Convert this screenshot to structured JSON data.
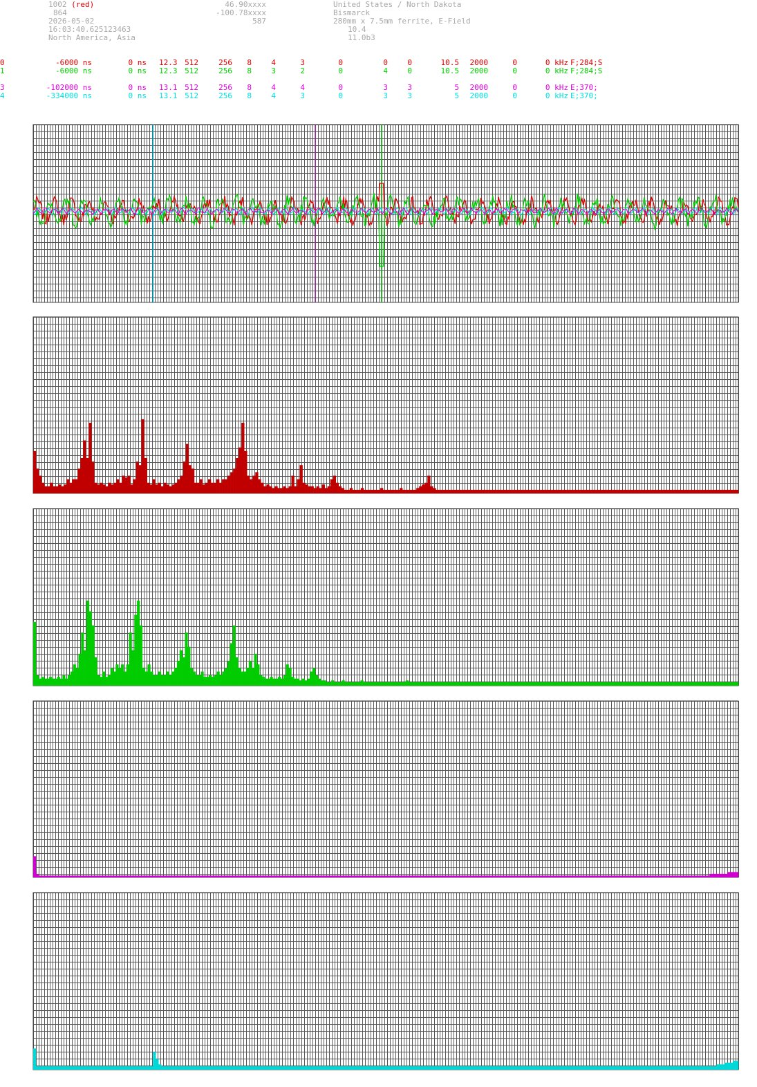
{
  "header": {
    "left": [
      "1002",
      "864",
      "2026-05-02",
      "16:03:40.625123463",
      "North America, Asia"
    ],
    "left_tag": "(red)",
    "mid": [
      "46.90xxxx",
      "-100.78xxxx",
      "587"
    ],
    "right": [
      "United States / North Dakota",
      "Bismarck",
      "280mm x 7.5mm ferrite, E-Field",
      "10.4",
      "11.0b3"
    ]
  },
  "channels": [
    {
      "color": "#e00000",
      "cells": [
        "0",
        "-6000 ns",
        "0 ns",
        "12.3",
        "512",
        "256",
        "8",
        "4",
        "3",
        "0",
        "0",
        "0",
        "10.5",
        "2000",
        "0",
        "0 kHz",
        "F;284;S"
      ]
    },
    {
      "color": "#00d000",
      "cells": [
        "1",
        "-6000 ns",
        "0 ns",
        "12.3",
        "512",
        "256",
        "8",
        "3",
        "2",
        "0",
        "4",
        "0",
        "10.5",
        "2000",
        "0",
        "0 kHz",
        "F;284;S"
      ]
    },
    {
      "color": "#e000e0",
      "cells": [
        "3",
        "-102000 ns",
        "0 ns",
        "13.1",
        "512",
        "256",
        "8",
        "4",
        "4",
        "0",
        "3",
        "3",
        "5",
        "2000",
        "0",
        "0 kHz",
        "E;370;"
      ]
    },
    {
      "color": "#00e0e0",
      "cells": [
        "4",
        "-334000 ns",
        "0 ns",
        "13.1",
        "512",
        "256",
        "8",
        "4",
        "3",
        "0",
        "3",
        "3",
        "5",
        "2000",
        "0",
        "0 kHz",
        "E;370;"
      ]
    }
  ],
  "chart_data": [
    {
      "type": "line",
      "cursors": [
        {
          "color": "#00b8e0",
          "x": 0.17
        },
        {
          "color": "#a020a0",
          "x": 0.4
        },
        {
          "color": "#00c000",
          "x": 0.494
        }
      ],
      "series": [
        {
          "color": "#e00000",
          "amplitude": 0.22
        },
        {
          "color": "#00d000",
          "amplitude": 0.26
        },
        {
          "color": "#00e0e0",
          "amplitude": 0.06
        },
        {
          "color": "#e000e0",
          "amplitude": 0.05
        }
      ]
    },
    {
      "type": "bar",
      "color": "#c00000",
      "ylim": [
        0,
        1
      ],
      "values": [
        0.24,
        0.14,
        0.1,
        0.06,
        0.04,
        0.04,
        0.06,
        0.04,
        0.04,
        0.05,
        0.04,
        0.05,
        0.08,
        0.06,
        0.08,
        0.08,
        0.14,
        0.2,
        0.3,
        0.2,
        0.4,
        0.18,
        0.06,
        0.05,
        0.06,
        0.05,
        0.04,
        0.06,
        0.05,
        0.06,
        0.08,
        0.06,
        0.1,
        0.09,
        0.1,
        0.05,
        0.08,
        0.18,
        0.16,
        0.42,
        0.2,
        0.06,
        0.05,
        0.08,
        0.05,
        0.06,
        0.04,
        0.06,
        0.05,
        0.04,
        0.05,
        0.06,
        0.08,
        0.1,
        0.18,
        0.28,
        0.16,
        0.14,
        0.06,
        0.06,
        0.08,
        0.05,
        0.06,
        0.08,
        0.06,
        0.06,
        0.08,
        0.06,
        0.08,
        0.08,
        0.1,
        0.12,
        0.14,
        0.2,
        0.26,
        0.4,
        0.24,
        0.1,
        0.08,
        0.1,
        0.12,
        0.08,
        0.06,
        0.04,
        0.05,
        0.04,
        0.03,
        0.04,
        0.03,
        0.03,
        0.04,
        0.03,
        0.04,
        0.1,
        0.04,
        0.08,
        0.16,
        0.06,
        0.05,
        0.04,
        0.04,
        0.03,
        0.04,
        0.03,
        0.05,
        0.03,
        0.04,
        0.08,
        0.1,
        0.06,
        0.04,
        0.03,
        0.02,
        0.02,
        0.03,
        0.02,
        0.02,
        0.02,
        0.03,
        0.02,
        0.02,
        0.02,
        0.02,
        0.02,
        0.02,
        0.03,
        0.02,
        0.02,
        0.02,
        0.02,
        0.02,
        0.02,
        0.03,
        0.02,
        0.02,
        0.02,
        0.02,
        0.02,
        0.03,
        0.04,
        0.05,
        0.06,
        0.1,
        0.04,
        0.03,
        0.02,
        0.02,
        0.02,
        0.02,
        0.02,
        0.02,
        0.02,
        0.02,
        0.02,
        0.02,
        0.02,
        0.02,
        0.02,
        0.02,
        0.02,
        0.02,
        0.02,
        0.02,
        0.02,
        0.02,
        0.02,
        0.02,
        0.02,
        0.02,
        0.02,
        0.02,
        0.02,
        0.02,
        0.02,
        0.02,
        0.02,
        0.02,
        0.02,
        0.02,
        0.02,
        0.02,
        0.02,
        0.02,
        0.02,
        0.02,
        0.02,
        0.02,
        0.02,
        0.02,
        0.02,
        0.02,
        0.02,
        0.02,
        0.02,
        0.02,
        0.02,
        0.02,
        0.02,
        0.02,
        0.02,
        0.02,
        0.02,
        0.02,
        0.02,
        0.02,
        0.02,
        0.02,
        0.02,
        0.02,
        0.02,
        0.02,
        0.02,
        0.02,
        0.02,
        0.02,
        0.02,
        0.02,
        0.02,
        0.02,
        0.02,
        0.02,
        0.02,
        0.02,
        0.02,
        0.02,
        0.02,
        0.02,
        0.02,
        0.02,
        0.02,
        0.02,
        0.02,
        0.02,
        0.02,
        0.02,
        0.02,
        0.02,
        0.02,
        0.02,
        0.02,
        0.02,
        0.02,
        0.02,
        0.02,
        0.02,
        0.02,
        0.02,
        0.02,
        0.02,
        0.02,
        0.02,
        0.02,
        0.02,
        0.02
      ]
    },
    {
      "type": "bar",
      "color": "#00cc00",
      "ylim": [
        0,
        1
      ],
      "values": [
        0.36,
        0.06,
        0.04,
        0.05,
        0.04,
        0.04,
        0.05,
        0.04,
        0.04,
        0.05,
        0.04,
        0.06,
        0.04,
        0.06,
        0.08,
        0.12,
        0.1,
        0.18,
        0.3,
        0.2,
        0.48,
        0.42,
        0.34,
        0.16,
        0.06,
        0.05,
        0.08,
        0.05,
        0.06,
        0.1,
        0.08,
        0.12,
        0.1,
        0.12,
        0.08,
        0.12,
        0.3,
        0.2,
        0.4,
        0.48,
        0.34,
        0.1,
        0.08,
        0.12,
        0.08,
        0.06,
        0.06,
        0.08,
        0.06,
        0.06,
        0.08,
        0.06,
        0.08,
        0.1,
        0.14,
        0.2,
        0.16,
        0.3,
        0.22,
        0.1,
        0.08,
        0.06,
        0.06,
        0.08,
        0.05,
        0.05,
        0.06,
        0.05,
        0.06,
        0.08,
        0.06,
        0.08,
        0.1,
        0.14,
        0.24,
        0.34,
        0.16,
        0.1,
        0.08,
        0.08,
        0.1,
        0.14,
        0.1,
        0.18,
        0.12,
        0.06,
        0.05,
        0.04,
        0.04,
        0.05,
        0.04,
        0.04,
        0.05,
        0.04,
        0.06,
        0.12,
        0.1,
        0.05,
        0.04,
        0.04,
        0.03,
        0.04,
        0.03,
        0.04,
        0.08,
        0.1,
        0.06,
        0.04,
        0.03,
        0.03,
        0.02,
        0.02,
        0.03,
        0.02,
        0.02,
        0.02,
        0.03,
        0.02,
        0.02,
        0.02,
        0.02,
        0.02,
        0.02,
        0.03,
        0.02,
        0.02,
        0.02,
        0.02,
        0.02,
        0.02,
        0.02,
        0.02,
        0.02,
        0.02,
        0.02,
        0.02,
        0.02,
        0.02,
        0.02,
        0.02,
        0.03,
        0.02,
        0.02,
        0.02,
        0.02,
        0.02,
        0.02,
        0.02,
        0.02,
        0.02,
        0.02,
        0.02,
        0.02,
        0.02,
        0.02,
        0.02,
        0.02,
        0.02,
        0.02,
        0.02,
        0.02,
        0.02,
        0.02,
        0.02,
        0.02,
        0.02,
        0.02,
        0.02,
        0.02,
        0.02,
        0.02,
        0.02,
        0.02,
        0.02,
        0.02,
        0.02,
        0.02,
        0.02,
        0.02,
        0.02,
        0.02,
        0.02,
        0.02,
        0.02,
        0.02,
        0.02,
        0.02,
        0.02,
        0.02,
        0.02,
        0.02,
        0.02,
        0.02,
        0.02,
        0.02,
        0.02,
        0.02,
        0.02,
        0.02,
        0.02,
        0.02,
        0.02,
        0.02,
        0.02,
        0.02,
        0.02,
        0.02,
        0.02,
        0.02,
        0.02,
        0.02,
        0.02,
        0.02,
        0.02,
        0.02,
        0.02,
        0.02,
        0.02,
        0.02,
        0.02,
        0.02,
        0.02,
        0.02,
        0.02,
        0.02,
        0.02,
        0.02,
        0.02,
        0.02,
        0.02,
        0.02,
        0.02,
        0.02,
        0.02,
        0.02,
        0.02,
        0.02,
        0.02,
        0.02,
        0.02,
        0.02,
        0.02,
        0.02,
        0.02,
        0.02,
        0.02,
        0.02,
        0.02,
        0.02,
        0.02,
        0.02,
        0.02,
        0.02,
        0.02,
        0.02,
        0.02,
        0.02,
        0.02,
        0.02,
        0.02,
        0.02,
        0.02,
        0.02,
        0.02,
        0.02
      ]
    },
    {
      "type": "bar",
      "color": "#d000d0",
      "ylim": [
        0,
        1
      ],
      "values": [
        0.12,
        0.02,
        0.01,
        0.01,
        0.01,
        0.01,
        0.01,
        0.01,
        0.01,
        0.01,
        0.01,
        0.01,
        0.01,
        0.01,
        0.01,
        0.01,
        0.01,
        0.01,
        0.01,
        0.01,
        0.01,
        0.01,
        0.01,
        0.01,
        0.01,
        0.01,
        0.01,
        0.01,
        0.01,
        0.01,
        0.01,
        0.01,
        0.01,
        0.01,
        0.01,
        0.01,
        0.01,
        0.01,
        0.01,
        0.01,
        0.01,
        0.01,
        0.01,
        0.01,
        0.01,
        0.01,
        0.01,
        0.01,
        0.01,
        0.01,
        0.01,
        0.01,
        0.01,
        0.01,
        0.01,
        0.01,
        0.01,
        0.01,
        0.01,
        0.01,
        0.01,
        0.01,
        0.01,
        0.01,
        0.01,
        0.01,
        0.01,
        0.01,
        0.01,
        0.01,
        0.01,
        0.01,
        0.01,
        0.01,
        0.01,
        0.01,
        0.01,
        0.01,
        0.01,
        0.01,
        0.01,
        0.01,
        0.01,
        0.01,
        0.01,
        0.01,
        0.01,
        0.01,
        0.01,
        0.01,
        0.01,
        0.01,
        0.01,
        0.01,
        0.01,
        0.01,
        0.01,
        0.01,
        0.01,
        0.01,
        0.01,
        0.01,
        0.01,
        0.01,
        0.01,
        0.01,
        0.01,
        0.01,
        0.01,
        0.01,
        0.01,
        0.01,
        0.01,
        0.01,
        0.01,
        0.01,
        0.01,
        0.01,
        0.01,
        0.01,
        0.01,
        0.01,
        0.01,
        0.01,
        0.01,
        0.01,
        0.01,
        0.01,
        0.01,
        0.01,
        0.01,
        0.01,
        0.01,
        0.01,
        0.01,
        0.01,
        0.01,
        0.01,
        0.01,
        0.01,
        0.01,
        0.01,
        0.01,
        0.01,
        0.01,
        0.01,
        0.01,
        0.01,
        0.01,
        0.01,
        0.01,
        0.01,
        0.01,
        0.01,
        0.01,
        0.01,
        0.01,
        0.01,
        0.01,
        0.01,
        0.01,
        0.01,
        0.01,
        0.01,
        0.01,
        0.01,
        0.01,
        0.01,
        0.01,
        0.01,
        0.01,
        0.01,
        0.01,
        0.01,
        0.01,
        0.01,
        0.01,
        0.01,
        0.01,
        0.01,
        0.01,
        0.01,
        0.01,
        0.01,
        0.01,
        0.01,
        0.01,
        0.01,
        0.01,
        0.01,
        0.01,
        0.01,
        0.01,
        0.01,
        0.01,
        0.01,
        0.01,
        0.01,
        0.01,
        0.01,
        0.01,
        0.01,
        0.01,
        0.01,
        0.01,
        0.01,
        0.01,
        0.01,
        0.01,
        0.01,
        0.01,
        0.01,
        0.01,
        0.01,
        0.01,
        0.01,
        0.01,
        0.01,
        0.01,
        0.01,
        0.01,
        0.01,
        0.01,
        0.01,
        0.01,
        0.01,
        0.01,
        0.01,
        0.01,
        0.01,
        0.01,
        0.01,
        0.01,
        0.01,
        0.01,
        0.01,
        0.01,
        0.01,
        0.01,
        0.01,
        0.01,
        0.01,
        0.01,
        0.01,
        0.01,
        0.01,
        0.01,
        0.01,
        0.01,
        0.01,
        0.01,
        0.01,
        0.01,
        0.01,
        0.01,
        0.01,
        0.01,
        0.01,
        0.02,
        0.02,
        0.02,
        0.02,
        0.02,
        0.02,
        0.02,
        0.03,
        0.03,
        0.03,
        0.03
      ]
    },
    {
      "type": "bar",
      "color": "#00d8d8",
      "ylim": [
        0,
        1
      ],
      "values": [
        0.12,
        0.02,
        0.02,
        0.02,
        0.02,
        0.02,
        0.02,
        0.02,
        0.02,
        0.02,
        0.02,
        0.02,
        0.02,
        0.02,
        0.02,
        0.02,
        0.02,
        0.02,
        0.02,
        0.02,
        0.02,
        0.02,
        0.02,
        0.02,
        0.02,
        0.02,
        0.02,
        0.02,
        0.02,
        0.02,
        0.02,
        0.02,
        0.02,
        0.02,
        0.02,
        0.02,
        0.02,
        0.02,
        0.02,
        0.02,
        0.02,
        0.02,
        0.02,
        0.02,
        0.1,
        0.06,
        0.03,
        0.02,
        0.02,
        0.02,
        0.02,
        0.02,
        0.02,
        0.02,
        0.02,
        0.02,
        0.02,
        0.02,
        0.02,
        0.02,
        0.02,
        0.02,
        0.02,
        0.02,
        0.02,
        0.02,
        0.02,
        0.02,
        0.02,
        0.02,
        0.02,
        0.02,
        0.02,
        0.02,
        0.02,
        0.02,
        0.02,
        0.02,
        0.02,
        0.02,
        0.02,
        0.02,
        0.02,
        0.02,
        0.02,
        0.02,
        0.02,
        0.02,
        0.02,
        0.02,
        0.02,
        0.02,
        0.02,
        0.02,
        0.02,
        0.02,
        0.02,
        0.02,
        0.02,
        0.02,
        0.02,
        0.02,
        0.02,
        0.02,
        0.02,
        0.02,
        0.02,
        0.02,
        0.02,
        0.02,
        0.02,
        0.02,
        0.02,
        0.02,
        0.02,
        0.02,
        0.02,
        0.02,
        0.02,
        0.02,
        0.02,
        0.02,
        0.02,
        0.02,
        0.02,
        0.02,
        0.02,
        0.02,
        0.02,
        0.02,
        0.02,
        0.02,
        0.02,
        0.02,
        0.02,
        0.02,
        0.02,
        0.02,
        0.02,
        0.02,
        0.02,
        0.02,
        0.02,
        0.02,
        0.02,
        0.02,
        0.02,
        0.02,
        0.02,
        0.02,
        0.02,
        0.02,
        0.02,
        0.02,
        0.02,
        0.02,
        0.02,
        0.02,
        0.02,
        0.02,
        0.02,
        0.02,
        0.02,
        0.02,
        0.02,
        0.02,
        0.02,
        0.02,
        0.02,
        0.02,
        0.02,
        0.02,
        0.02,
        0.02,
        0.02,
        0.02,
        0.02,
        0.02,
        0.02,
        0.02,
        0.02,
        0.02,
        0.02,
        0.02,
        0.02,
        0.02,
        0.02,
        0.02,
        0.02,
        0.02,
        0.02,
        0.02,
        0.02,
        0.02,
        0.02,
        0.02,
        0.02,
        0.02,
        0.02,
        0.02,
        0.02,
        0.02,
        0.02,
        0.02,
        0.02,
        0.02,
        0.02,
        0.02,
        0.02,
        0.02,
        0.02,
        0.02,
        0.02,
        0.02,
        0.02,
        0.02,
        0.02,
        0.02,
        0.02,
        0.02,
        0.02,
        0.02,
        0.02,
        0.02,
        0.02,
        0.02,
        0.02,
        0.02,
        0.02,
        0.02,
        0.02,
        0.02,
        0.02,
        0.02,
        0.02,
        0.02,
        0.02,
        0.02,
        0.02,
        0.02,
        0.02,
        0.02,
        0.02,
        0.02,
        0.02,
        0.02,
        0.02,
        0.02,
        0.02,
        0.02,
        0.02,
        0.03,
        0.03,
        0.03,
        0.04,
        0.04,
        0.04,
        0.05,
        0.05
      ]
    }
  ]
}
